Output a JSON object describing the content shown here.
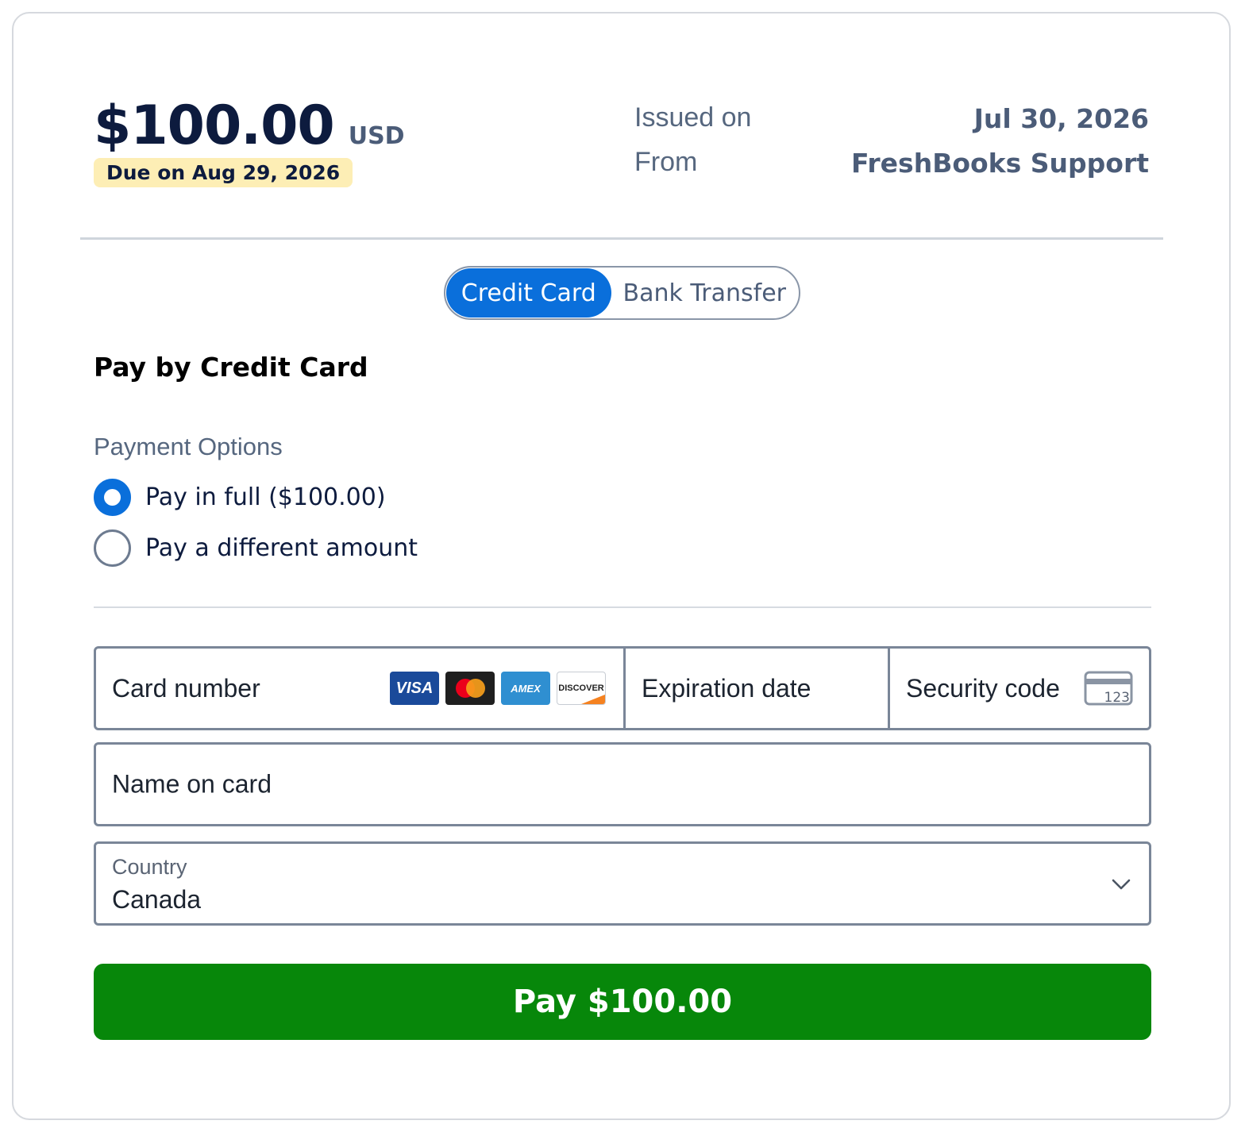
{
  "invoice": {
    "amount": "$100.00",
    "currency": "USD",
    "due": "Due on Aug 29, 2026",
    "issued_label": "Issued on",
    "issued_value": "Jul 30, 2026",
    "from_label": "From",
    "from_value": "FreshBooks Support"
  },
  "tabs": [
    {
      "label": "Credit Card",
      "active": true
    },
    {
      "label": "Bank Transfer",
      "active": false
    }
  ],
  "section_title": "Pay by Credit Card",
  "payment_options": {
    "label": "Payment Options",
    "options": [
      {
        "label": "Pay in full ($100.00)",
        "checked": true
      },
      {
        "label": "Pay a different amount",
        "checked": false
      }
    ]
  },
  "card_form": {
    "card_number_placeholder": "Card number",
    "brands": [
      "VISA",
      "mastercard",
      "AMEX",
      "DISCOVER"
    ],
    "expiration_placeholder": "Expiration date",
    "security_placeholder": "Security code",
    "security_icon_text": "123",
    "name_placeholder": "Name on card",
    "country_label": "Country",
    "country_value": "Canada"
  },
  "pay_button": "Pay $100.00",
  "colors": {
    "primary": "#0a6fdb",
    "pay_green": "#07870a",
    "due_badge_bg": "#fdeeb5",
    "navy": "#0d1b3e"
  }
}
